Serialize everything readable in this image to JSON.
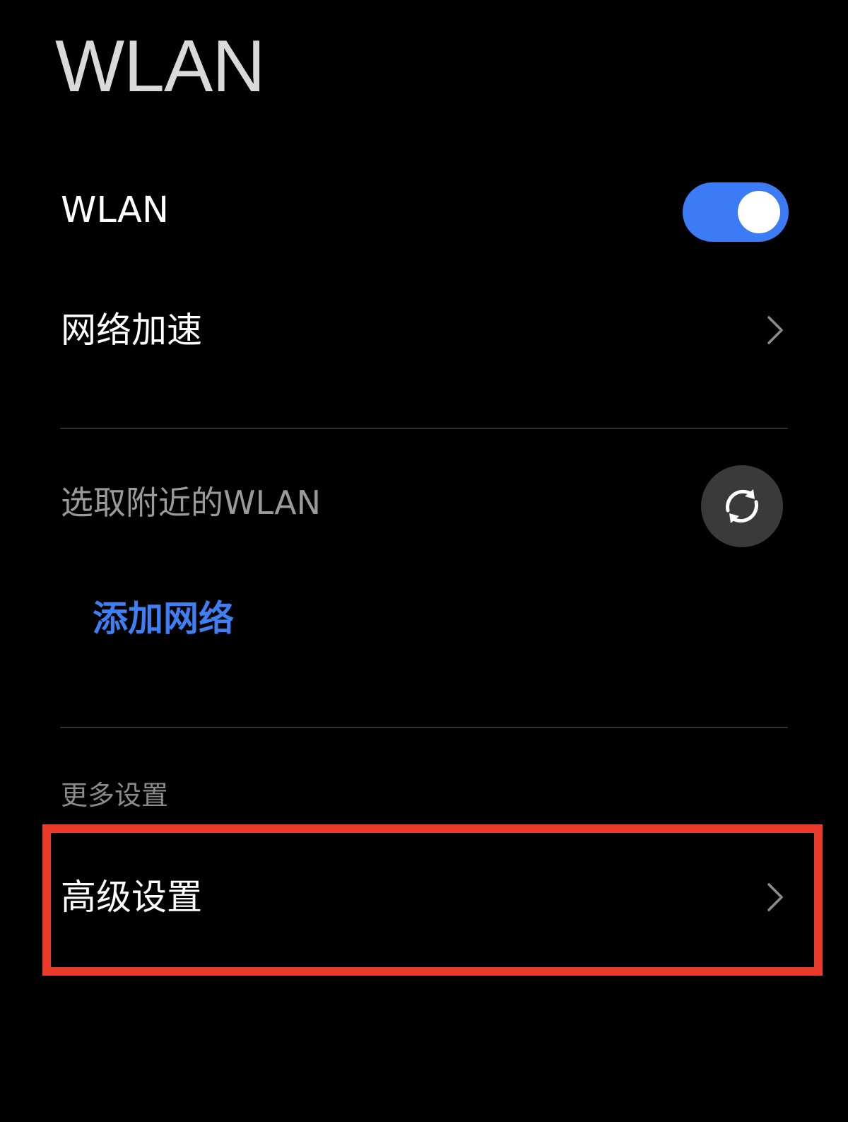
{
  "header": {
    "title": "WLAN"
  },
  "wlan_toggle": {
    "label": "WLAN",
    "state": "on",
    "accent_color": "#3b7bf6"
  },
  "network_acceleration": {
    "label": "网络加速",
    "icon": "chevron-right-icon"
  },
  "nearby_networks": {
    "label": "选取附近的WLAN",
    "refresh_icon": "refresh-icon"
  },
  "add_network": {
    "label": "添加网络",
    "color": "#3f7ef3"
  },
  "more_settings": {
    "header": "更多设置",
    "items": [
      {
        "label": "高级设置",
        "icon": "chevron-right-icon",
        "highlighted": true
      }
    ]
  },
  "highlight_color": "#ea3a2a"
}
